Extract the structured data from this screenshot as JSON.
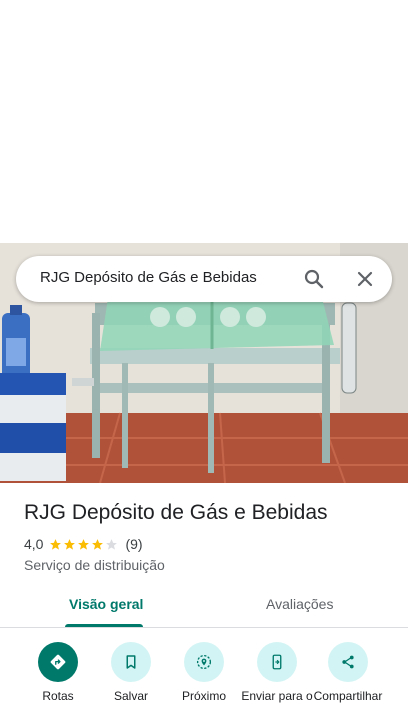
{
  "search": {
    "query": "RJG Depósito de Gás e Bebidas"
  },
  "place": {
    "name": "RJG Depósito de Gás e Bebidas",
    "rating": "4,0",
    "stars": 4,
    "review_count": "(9)",
    "category": "Serviço de distribuição"
  },
  "tabs": [
    {
      "label": "Visão geral",
      "active": true
    },
    {
      "label": "Avaliações",
      "active": false
    }
  ],
  "actions": [
    {
      "label": "Rotas",
      "icon": "directions-icon"
    },
    {
      "label": "Salvar",
      "icon": "bookmark-icon"
    },
    {
      "label": "Próximo",
      "icon": "nearby-icon"
    },
    {
      "label": "Enviar para o",
      "icon": "send-to-phone-icon"
    },
    {
      "label": "Compartilhar",
      "icon": "share-icon"
    }
  ],
  "colors": {
    "accent": "#00796b",
    "action_bg": "#d3f4f4",
    "star": "#fbbc04"
  }
}
